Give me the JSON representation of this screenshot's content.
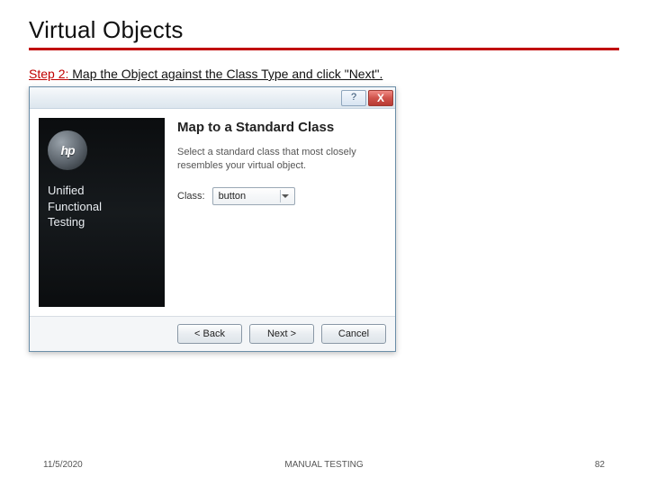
{
  "slide": {
    "title": "Virtual Objects",
    "step_prefix": "Step 2:",
    "step_text": " Map the Object against the Class Type and click \"Next\"."
  },
  "dialog": {
    "titlebar": {
      "help_glyph": "?",
      "close_glyph": "X"
    },
    "sidebar": {
      "logo_text": "hp",
      "product_line1": "Unified",
      "product_line2": "Functional",
      "product_line3": "Testing"
    },
    "content": {
      "heading": "Map to a Standard Class",
      "subtext": "Select a standard class that most closely resembles your virtual object.",
      "class_label": "Class:",
      "class_value": "button"
    },
    "buttons": {
      "back": "< Back",
      "next": "Next >",
      "cancel": "Cancel"
    }
  },
  "footer": {
    "date": "11/5/2020",
    "center": "MANUAL TESTING",
    "page": "82"
  }
}
